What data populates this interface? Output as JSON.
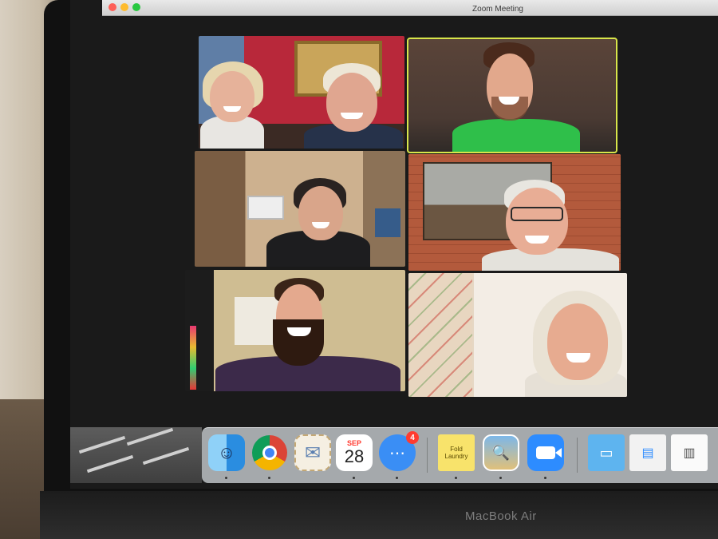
{
  "window": {
    "title": "Zoom Meeting"
  },
  "device": {
    "label": "MacBook Air"
  },
  "meeting": {
    "active_speaker_color": "#d8e64a",
    "participants": [
      {
        "tile": "top-left",
        "icon": "two-people"
      },
      {
        "tile": "top-right",
        "icon": "person",
        "active": true
      },
      {
        "tile": "middle-left",
        "icon": "person"
      },
      {
        "tile": "middle-right",
        "icon": "person"
      },
      {
        "tile": "bottom-left",
        "icon": "person"
      },
      {
        "tile": "bottom-right",
        "icon": "person"
      }
    ]
  },
  "dock": {
    "calendar_month": "SEP",
    "calendar_day": "28",
    "messages_badge": "4",
    "stickies_note": "Fold Laundry"
  },
  "colors": {
    "zoom_blue": "#2d8cff",
    "badge_red": "#ff3b30"
  }
}
